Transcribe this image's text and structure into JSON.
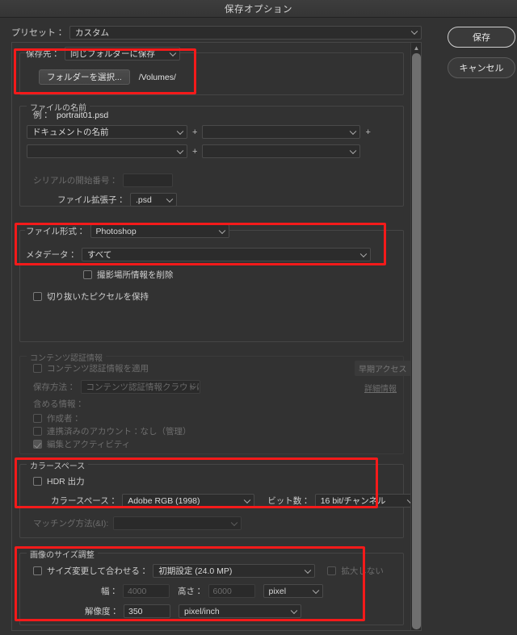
{
  "window": {
    "title": "保存オプション"
  },
  "preset": {
    "label": "プリセット：",
    "value": "カスタム"
  },
  "save_to": {
    "label": "保存先：",
    "value": "同じフォルダーに保存",
    "choose_folder_button": "フォルダーを選択...",
    "path": "/Volumes/"
  },
  "file_name": {
    "legend": "ファイルの名前",
    "example_label": "例：",
    "example_value": "portrait01.psd",
    "token1": "ドキュメントの名前",
    "token2": "",
    "token3": "",
    "token4": "",
    "plus": "+",
    "serial_label": "シリアルの開始番号：",
    "serial_value": "",
    "extension_label": "ファイル拡張子：",
    "extension_value": ".psd"
  },
  "file_format": {
    "label": "ファイル形式：",
    "value": "Photoshop",
    "metadata_label": "メタデータ：",
    "metadata_value": "すべて",
    "remove_location_checkbox": "撮影場所情報を削除",
    "keep_cropped_pixels_checkbox": "切り抜いたピクセルを保持"
  },
  "content_credentials": {
    "legend": "コンテンツ認証情報",
    "apply_checkbox": "コンテンツ認証情報を適用",
    "early_access_badge": "早期アクセス",
    "save_method_label": "保存方法：",
    "save_method_value": "コンテンツ認証情報クラウドに公開",
    "more_info_link": "詳細情報",
    "include_label": "含める情報：",
    "creator_checkbox": "作成者：",
    "linked_account_checkbox": "連携済みのアカウント：なし（管理）",
    "edits_activity_checkbox": "編集とアクティビティ"
  },
  "color_space": {
    "legend": "カラースペース",
    "hdr_checkbox": "HDR 出力",
    "color_space_label": "カラースペース：",
    "color_space_value": "Adobe RGB (1998)",
    "bit_depth_label": "ビット数：",
    "bit_depth_value": "16 bit/チャンネル",
    "matching_label": "マッチング方法(&I):",
    "matching_value": ""
  },
  "image_size": {
    "legend": "画像のサイズ調整",
    "resize_checkbox": "サイズ変更して合わせる：",
    "resize_value": "初期設定 (24.0 MP)",
    "no_enlarge_checkbox": "拡大しない",
    "width_label": "幅：",
    "width_value": "4000",
    "height_label": "高さ：",
    "height_value": "6000",
    "unit_value": "pixel",
    "resolution_label": "解像度：",
    "resolution_value": "350",
    "resolution_unit_value": "pixel/inch"
  },
  "actions": {
    "save": "保存",
    "cancel": "キャンセル"
  },
  "scrollbar": {
    "up_arrow": "▲"
  },
  "colors": {
    "annotation": "#f41a1a",
    "background": "#323232",
    "accent_border": "#cfcfcf"
  }
}
